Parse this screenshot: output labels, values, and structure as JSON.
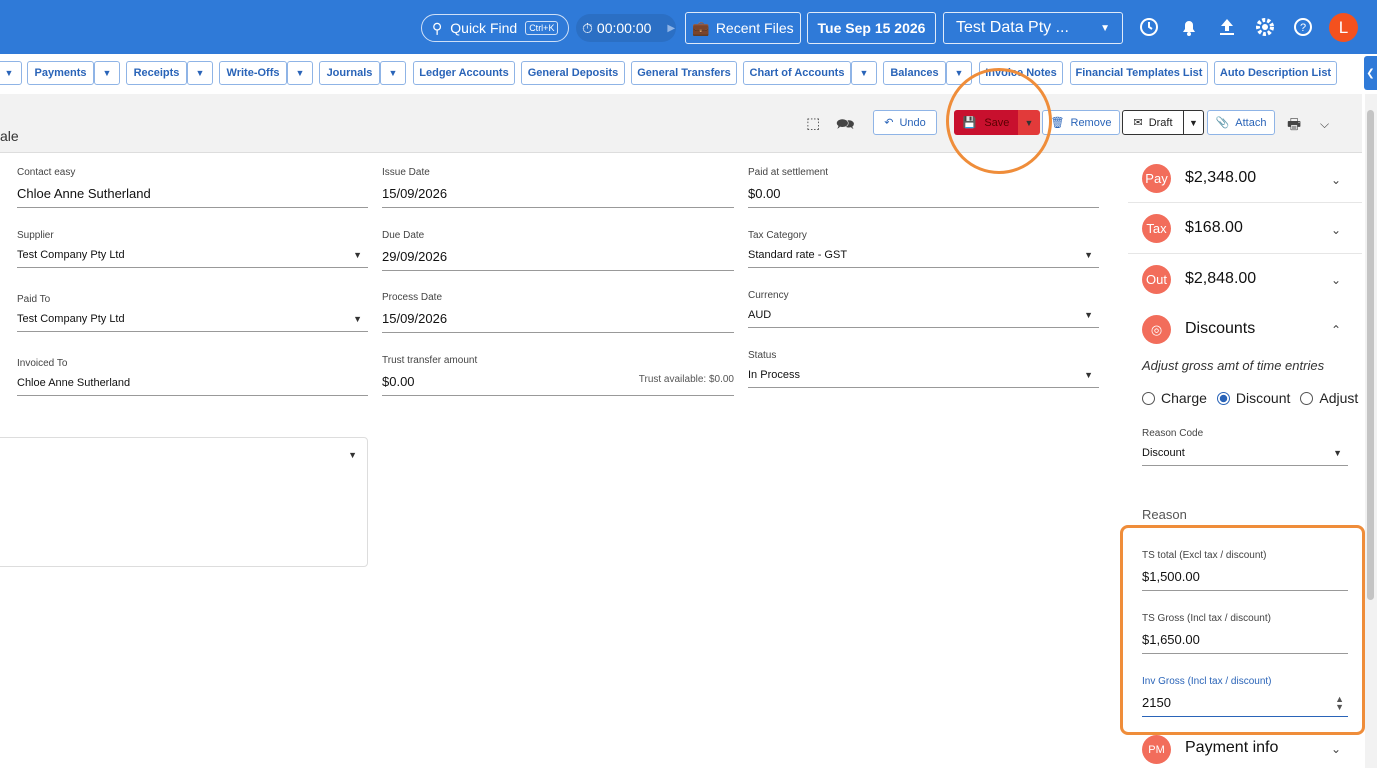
{
  "topbar": {
    "quick_find": "Quick Find",
    "quick_find_shortcut": "Ctrl+K",
    "timer": "00:00:00",
    "recent_files": "Recent Files",
    "date": "Tue Sep 15 2026",
    "company": "Test Data Pty ...",
    "avatar_initial": "L"
  },
  "nav": {
    "payments": "Payments",
    "receipts": "Receipts",
    "write_offs": "Write-Offs",
    "journals": "Journals",
    "ledger_accounts": "Ledger Accounts",
    "general_deposits": "General Deposits",
    "general_transfers": "General Transfers",
    "chart_of_accounts": "Chart of Accounts",
    "balances": "Balances",
    "invoice_notes": "Invoice Notes",
    "financial_templates": "Financial Templates List",
    "auto_description": "Auto Description List"
  },
  "toolbar": {
    "title_fragment": "ale",
    "undo": "Undo",
    "save": "Save",
    "remove": "Remove",
    "draft": "Draft",
    "attach": "Attach"
  },
  "form": {
    "contact_label": "Contact easy",
    "contact_value": "Chloe Anne Sutherland",
    "supplier_label": "Supplier",
    "supplier_value": "Test Company Pty Ltd",
    "paid_to_label": "Paid To",
    "paid_to_value": "Test Company Pty Ltd",
    "invoiced_to_label": "Invoiced To",
    "invoiced_to_value": "Chloe Anne Sutherland",
    "issue_date_label": "Issue Date",
    "issue_date_value": "15/09/2026",
    "due_date_label": "Due Date",
    "due_date_value": "29/09/2026",
    "process_date_label": "Process Date",
    "process_date_value": "15/09/2026",
    "trust_transfer_label": "Trust transfer amount",
    "trust_transfer_value": "$0.00",
    "trust_available": "Trust available: $0.00",
    "paid_settlement_label": "Paid at settlement",
    "paid_settlement_value": "$0.00",
    "tax_category_label": "Tax Category",
    "tax_category_value": "Standard rate - GST",
    "currency_label": "Currency",
    "currency_value": "AUD",
    "status_label": "Status",
    "status_value": "In Process"
  },
  "right_panel": {
    "pay_badge": "Pay",
    "pay_amount": "$2,348.00",
    "tax_badge": "Tax",
    "tax_amount": "$168.00",
    "out_badge": "Out",
    "out_amount": "$2,848.00",
    "discounts_title": "Discounts",
    "discounts_hint": "Adjust gross amt of time entries",
    "opt_charge": "Charge",
    "opt_discount": "Discount",
    "opt_adjust": "Adjust",
    "reason_code_label": "Reason Code",
    "reason_code_value": "Discount",
    "reason_label": "Reason",
    "ts_total_label": "TS total (Excl tax / discount)",
    "ts_total_value": "$1,500.00",
    "ts_gross_label": "TS Gross (Incl tax / discount)",
    "ts_gross_value": "$1,650.00",
    "inv_gross_label": "Inv Gross (Incl tax / discount)",
    "inv_gross_value": "2150",
    "pm_badge": "PM",
    "payment_info": "Payment info"
  },
  "colors": {
    "brand_blue": "#2f7ad8",
    "save_red": "#c8102e",
    "highlight_orange": "#ef8d3a",
    "badge_coral": "#f26d5b"
  }
}
